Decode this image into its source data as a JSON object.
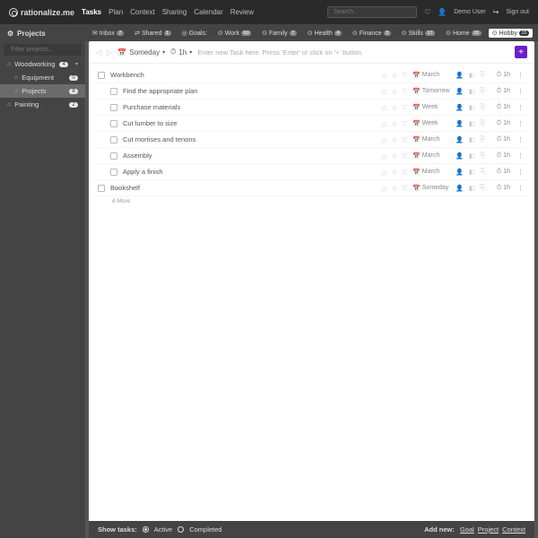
{
  "header": {
    "app_name": "rationalize.me",
    "nav": [
      "Tasks",
      "Plan",
      "Context",
      "Sharing",
      "Calendar",
      "Review"
    ],
    "active_nav": "Tasks",
    "search_placeholder": "Search...",
    "user": "Demo User",
    "signout": "Sign out"
  },
  "sidebar": {
    "title": "Projects",
    "filter_placeholder": "Filter projects...",
    "items": [
      {
        "level": 1,
        "icon": "⌂",
        "label": "Woodworking",
        "badge": "4",
        "caret": true
      },
      {
        "level": 2,
        "icon": "⌂",
        "label": "Equipment",
        "badge": "0"
      },
      {
        "level": 2,
        "icon": "⌂",
        "label": "Projects",
        "badge": "8",
        "selected": true
      },
      {
        "level": 1,
        "icon": "⌂",
        "label": "Painting",
        "badge": "2"
      }
    ]
  },
  "tabs": {
    "left": [
      {
        "icon": "✉",
        "label": "Inbox",
        "badge": "7"
      },
      {
        "icon": "⇄",
        "label": "Shared",
        "badge": "1"
      }
    ],
    "goals_label": "Goals:",
    "goals": [
      {
        "icon": "⊙",
        "label": "Work",
        "badge": "60"
      },
      {
        "icon": "⊙",
        "label": "Family",
        "badge": "7"
      },
      {
        "icon": "⊙",
        "label": "Health",
        "badge": "4"
      },
      {
        "icon": "⊙",
        "label": "Finance",
        "badge": "3"
      },
      {
        "icon": "⊙",
        "label": "Skills",
        "badge": "17"
      },
      {
        "icon": "⊙",
        "label": "Home",
        "badge": "20"
      },
      {
        "icon": "⊙",
        "label": "Hobby",
        "badge": "15",
        "active": true
      }
    ]
  },
  "panel": {
    "schedule_label": "Someday",
    "duration_label": "1h",
    "new_task_prompt": "Enter new Task here. Press 'Enter' or click on '+' button."
  },
  "tasks": [
    {
      "name": "Workbench",
      "child": false,
      "schedule": "March",
      "dur": "1h"
    },
    {
      "name": "Find the appropriate plan",
      "child": true,
      "schedule": "Tomorrow",
      "dur": "1h"
    },
    {
      "name": "Purchase materials",
      "child": true,
      "schedule": "Week",
      "dur": "1h"
    },
    {
      "name": "Cut lumber to size",
      "child": true,
      "schedule": "Week",
      "dur": "1h"
    },
    {
      "name": "Cut mortises and tenons",
      "child": true,
      "schedule": "March",
      "dur": "1h"
    },
    {
      "name": "Assembly",
      "child": true,
      "schedule": "March",
      "dur": "1h"
    },
    {
      "name": "Apply a finish",
      "child": true,
      "schedule": "March",
      "dur": "1h"
    },
    {
      "name": "Bookshelf",
      "child": false,
      "schedule": "Someday",
      "dur": "1h"
    }
  ],
  "more_label": "6 More",
  "footer": {
    "show_label": "Show tasks:",
    "opt_active": "Active",
    "opt_completed": "Completed",
    "addnew_label": "Add new:",
    "addnew_links": [
      "Goal",
      "Project",
      "Context"
    ]
  }
}
